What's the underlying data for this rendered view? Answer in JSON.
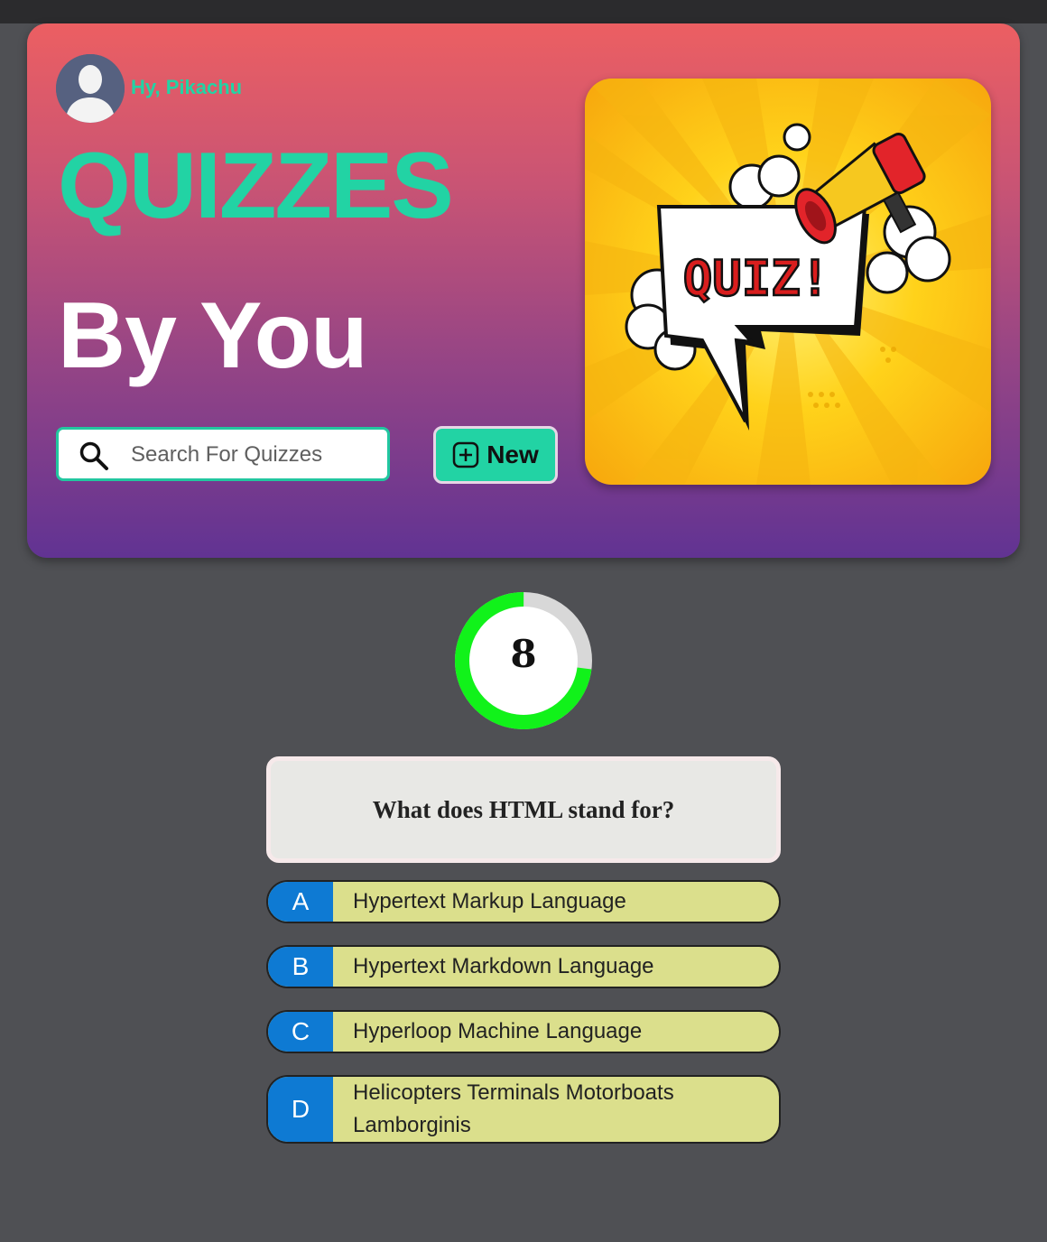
{
  "header": {
    "greeting": "Hy, Pikachu",
    "title_line1": "QUIZZES",
    "title_line2": "By You",
    "search_placeholder": "Search For Quizzes",
    "new_button_label": "New",
    "banner_text": "QUIZ!"
  },
  "timer": {
    "value": "8",
    "progress_fraction": 0.73,
    "ring_color": "#11f21a",
    "track_color": "#d8d8d8"
  },
  "question": {
    "text": "What does HTML stand for?"
  },
  "options": [
    {
      "letter": "A",
      "text": "Hypertext Markup Language"
    },
    {
      "letter": "B",
      "text": "Hypertext Markdown Language"
    },
    {
      "letter": "C",
      "text": "Hyperloop Machine Language"
    },
    {
      "letter": "D",
      "text": "Helicopters Terminals Motorboats Lamborginis"
    }
  ],
  "colors": {
    "accent": "#22d3a4",
    "option_letter_bg": "#0e7ad3",
    "option_bg": "#dbdf8c"
  }
}
